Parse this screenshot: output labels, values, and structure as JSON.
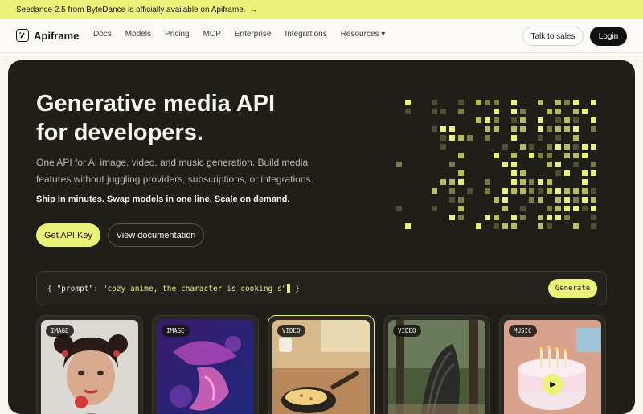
{
  "banner": {
    "text": "Seedance 2.5 from ByteDance is officially available on Apiframe.",
    "arrow": "→"
  },
  "nav": {
    "logo": "Apiframe",
    "links": [
      "Docs",
      "Models",
      "Pricing",
      "MCP",
      "Enterprise",
      "Integrations",
      "Resources ▾"
    ],
    "sales": "Talk to sales",
    "login": "Login"
  },
  "hero": {
    "title_line1": "Generative media API",
    "title_line2": "for developers.",
    "description": "One API for AI image, video, and music generation. Build media features without juggling providers, subscriptions, or integrations.",
    "tagline": "Ship in minutes. Swap models in one line. Scale on demand.",
    "primary_cta": "Get API Key",
    "secondary_cta": "View documentation"
  },
  "prompt": {
    "open": "{ ",
    "key": "\"prompt\": ",
    "value": "\"cozy anime, the character is cooking s\"",
    "close": " }",
    "generate": "Generate"
  },
  "cards": [
    {
      "label": "IMAGE"
    },
    {
      "label": "IMAGE"
    },
    {
      "label": "VIDEO"
    },
    {
      "label": "VIDEO"
    },
    {
      "label": "MUSIC"
    }
  ],
  "colors": {
    "accent": "#eaf27a",
    "dark": "#1f1e19"
  }
}
